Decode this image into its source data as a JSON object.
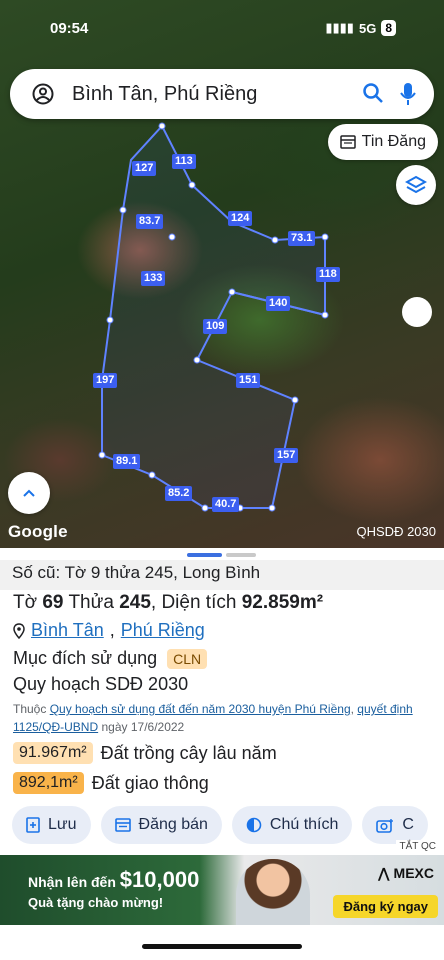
{
  "status_bar": {
    "time": "09:54",
    "network": "5G",
    "battery": "8"
  },
  "search": {
    "value": "Bình Tân, Phú Riềng"
  },
  "map": {
    "tin_dang_label": "Tin Đăng",
    "google_label": "Google",
    "layer_label": "QHSDĐ 2030",
    "plot_edges": [
      "127",
      "113",
      "124",
      "73.1",
      "118",
      "83.7",
      "133",
      "140",
      "109",
      "151",
      "197",
      "157",
      "89.1",
      "85.2",
      "40.7"
    ]
  },
  "sheet": {
    "old_info": "Số cũ: Tờ 9 thửa 245, Long Bình",
    "to_label": "Tờ",
    "to_value": "69",
    "thua_label": "Thửa",
    "thua_value": "245",
    "dien_tich_label": ", Diện tích",
    "dien_tich_value": "92.859m²",
    "commune": "Bình Tân",
    "district": "Phú Riềng",
    "purpose_label": "Mục đích sử dụng",
    "purpose_code": "CLN",
    "plan_label": "Quy hoạch SDĐ 2030",
    "note_prefix": "Thuộc",
    "note_link1": "Quy hoạch sử dụng đất đến năm 2030 huyện Phú Riềng",
    "note_link2": "quyết định 1125/QĐ-UBND",
    "note_date": "ngày 17/6/2022",
    "areas": [
      {
        "value": "91.967m²",
        "label": "Đất trồng cây lâu năm"
      },
      {
        "value": "892,1m²",
        "label": "Đất giao thông"
      }
    ],
    "actions": [
      "Lưu",
      "Đăng bán",
      "Chú thích",
      "C"
    ]
  },
  "ad": {
    "tag": "TẮT QC",
    "line1": "Nhận lên đến",
    "amount": "$10,000",
    "line2": "Quà tặng chào mừng!",
    "brand": "MEXC",
    "cta": "Đăng ký ngay"
  },
  "colors": {
    "plot_outline": "#3c5ff0",
    "accent": "#1a73e8"
  }
}
